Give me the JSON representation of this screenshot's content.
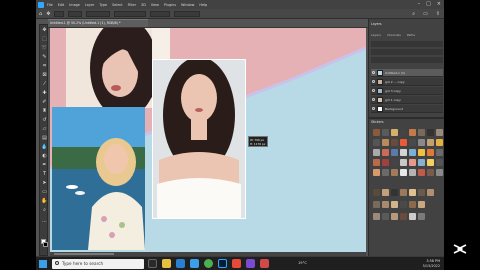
{
  "app": {
    "menu": [
      "File",
      "Edit",
      "Image",
      "Layer",
      "Type",
      "Select",
      "Filter",
      "3D",
      "View",
      "Plugins",
      "Window",
      "Help"
    ]
  },
  "document": {
    "tab_title": "Untitled-1 @ 50.2% (Untitled-1 (1), RGB/8) *"
  },
  "canvas": {
    "coord_w": "W: 706 px",
    "coord_h": "H: 1176 px"
  },
  "layers_panel": {
    "title": "Layers",
    "tabs": [
      "Layers",
      "Channels",
      "Paths"
    ],
    "layers": [
      {
        "name": "Untitled-1 (1)"
      },
      {
        "name": "girl 2 ... copy"
      },
      {
        "name": "girl 3 copy"
      },
      {
        "name": "girl 1 copy"
      },
      {
        "name": "Background"
      }
    ]
  },
  "stickers_panel": {
    "title": "Stickers"
  },
  "taskbar": {
    "search_placeholder": "Type here to search",
    "weather": "19°C",
    "time": "3:58 PM",
    "date": "5/15/2022"
  },
  "colors": {
    "ps_blue": "#31a8ff",
    "canvas_pink": "#e6b1b4",
    "canvas_blue": "#b8d9e6",
    "taskbar": "#1f1f1f"
  }
}
